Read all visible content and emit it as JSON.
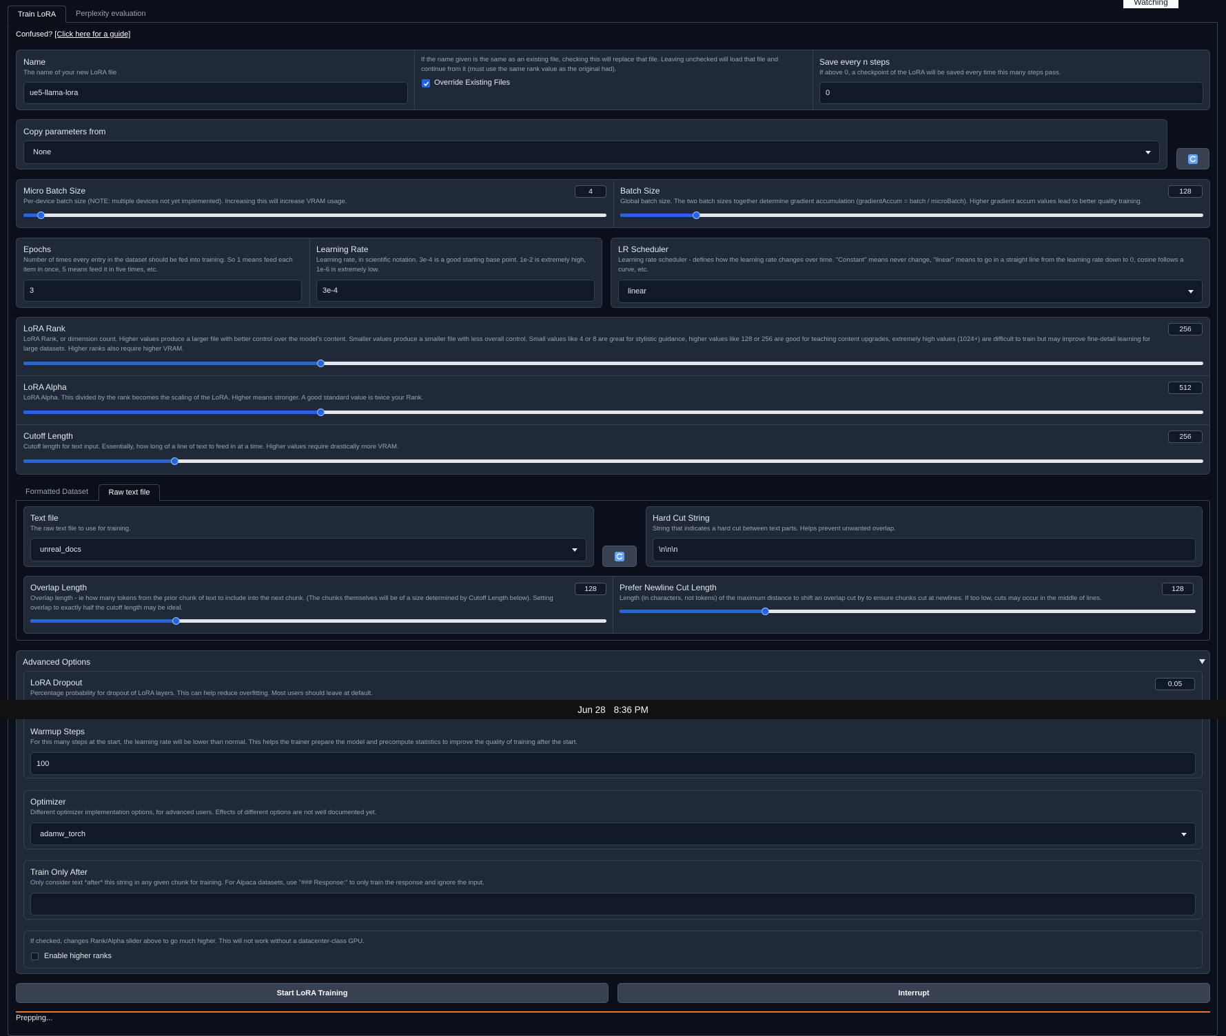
{
  "tabs": [
    "Train LoRA",
    "Perplexity evaluation"
  ],
  "watching_label": "Watching",
  "guide": {
    "prefix": "Confused?",
    "link": "[Click here for a guide]"
  },
  "name": {
    "label": "Name",
    "desc": "The name of your new LoRA file",
    "value": "ue5-llama-lora"
  },
  "override": {
    "desc": "If the name given is the same as an existing file, checking this will replace that file. Leaving unchecked will load that file and continue from it (must use the same rank value as the original had).",
    "label": "Override Existing Files",
    "checked": true
  },
  "save_every": {
    "label": "Save every n steps",
    "desc": "If above 0, a checkpoint of the LoRA will be saved every time this many steps pass.",
    "value": "0"
  },
  "copy_params": {
    "label": "Copy parameters from",
    "value": "None"
  },
  "micro_batch": {
    "label": "Micro Batch Size",
    "desc": "Per-device batch size (NOTE: multiple devices not yet implemented). Increasing this will increase VRAM usage.",
    "value": "4",
    "fraction": 0.03
  },
  "batch_size": {
    "label": "Batch Size",
    "desc": "Global batch size. The two batch sizes together determine gradient accumulation (gradientAccum = batch / microBatch). Higher gradient accum values lead to better quality training.",
    "value": "128",
    "fraction": 0.13
  },
  "epochs": {
    "label": "Epochs",
    "desc": "Number of times every entry in the dataset should be fed into training. So 1 means feed each item in once, 5 means feed it in five times, etc.",
    "value": "3"
  },
  "learning_rate": {
    "label": "Learning Rate",
    "desc": "Learning rate, in scientific notation. 3e-4 is a good starting base point. 1e-2 is extremely high, 1e-6 is extremely low.",
    "value": "3e-4"
  },
  "lr_scheduler": {
    "label": "LR Scheduler",
    "desc": "Learning rate scheduler - defines how the learning rate changes over time. \"Constant\" means never change, \"linear\" means to go in a straight line from the learning rate down to 0, cosine follows a curve, etc.",
    "value": "linear"
  },
  "lora_rank": {
    "label": "LoRA Rank",
    "desc": "LoRA Rank, or dimension count. Higher values produce a larger file with better control over the model's content. Smaller values produce a smaller file with less overall control. Small values like 4 or 8 are great for stylistic guidance, higher values like 128 or 256 are good for teaching content upgrades, extremely high values (1024+) are difficult to train but may improve fine-detail learning for large datasets. Higher ranks also require higher VRAM.",
    "value": "256",
    "fraction": 0.252
  },
  "lora_alpha": {
    "label": "LoRA Alpha",
    "desc": "LoRA Alpha. This divided by the rank becomes the scaling of the LoRA. Higher means stronger. A good standard value is twice your Rank.",
    "value": "512",
    "fraction": 0.252
  },
  "cutoff_len": {
    "label": "Cutoff Length",
    "desc": "Cutoff length for text input. Essentially, how long of a line of text to feed in at a time. Higher values require drastically more VRAM.",
    "value": "256",
    "fraction": 0.128
  },
  "dataset_tabs": [
    "Formatted Dataset",
    "Raw text file"
  ],
  "text_file": {
    "label": "Text file",
    "desc": "The raw text file to use for training.",
    "value": "unreal_docs"
  },
  "hard_cut": {
    "label": "Hard Cut String",
    "desc": "String that indicates a hard cut between text parts. Helps prevent unwanted overlap.",
    "value": "\\n\\n\\n"
  },
  "overlap_len": {
    "label": "Overlap Length",
    "desc": "Overlap length - ie how many tokens from the prior chunk of text to include into the next chunk. (The chunks themselves will be of a size determined by Cutoff Length below). Setting overlap to exactly half the cutoff length may be ideal.",
    "value": "128",
    "fraction": 0.252
  },
  "newline_cut": {
    "label": "Prefer Newline Cut Length",
    "desc": "Length (in characters, not tokens) of the maximum distance to shift an overlap cut by to ensure chunks cut at newlines. If too low, cuts may occur in the middle of lines.",
    "value": "128",
    "fraction": 0.252
  },
  "advanced": {
    "label": "Advanced Options"
  },
  "lora_dropout": {
    "label": "LoRA Dropout",
    "desc": "Percentage probability for dropout of LoRA layers. This can help reduce overfitting. Most users should leave at default.",
    "value": "0.05"
  },
  "clock": {
    "date": "Jun 28",
    "time": "8:36 PM"
  },
  "warmup": {
    "label": "Warmup Steps",
    "desc": "For this many steps at the start, the learning rate will be lower than normal. This helps the trainer prepare the model and precompute statistics to improve the quality of training after the start.",
    "value": "100"
  },
  "optimizer": {
    "label": "Optimizer",
    "desc": "Different optimizer implementation options, for advanced users. Effects of different options are not well documented yet.",
    "value": "adamw_torch"
  },
  "train_only_after": {
    "label": "Train Only After",
    "desc": "Only consider text *after* this string in any given chunk for training. For Alpaca datasets, use \"### Response:\" to only train the response and ignore the input.",
    "value": ""
  },
  "higher_ranks": {
    "desc": "If checked, changes Rank/Alpha slider above to go much higher. This will not work without a datacenter-class GPU.",
    "label": "Enable higher ranks",
    "checked": false
  },
  "buttons": {
    "start": "Start LoRA Training",
    "interrupt": "Interrupt"
  },
  "status": "Prepping...",
  "colors": {
    "accent": "#2563eb",
    "progress": "#f97316",
    "panel": "#1f2937",
    "background": "#0b0f19"
  }
}
